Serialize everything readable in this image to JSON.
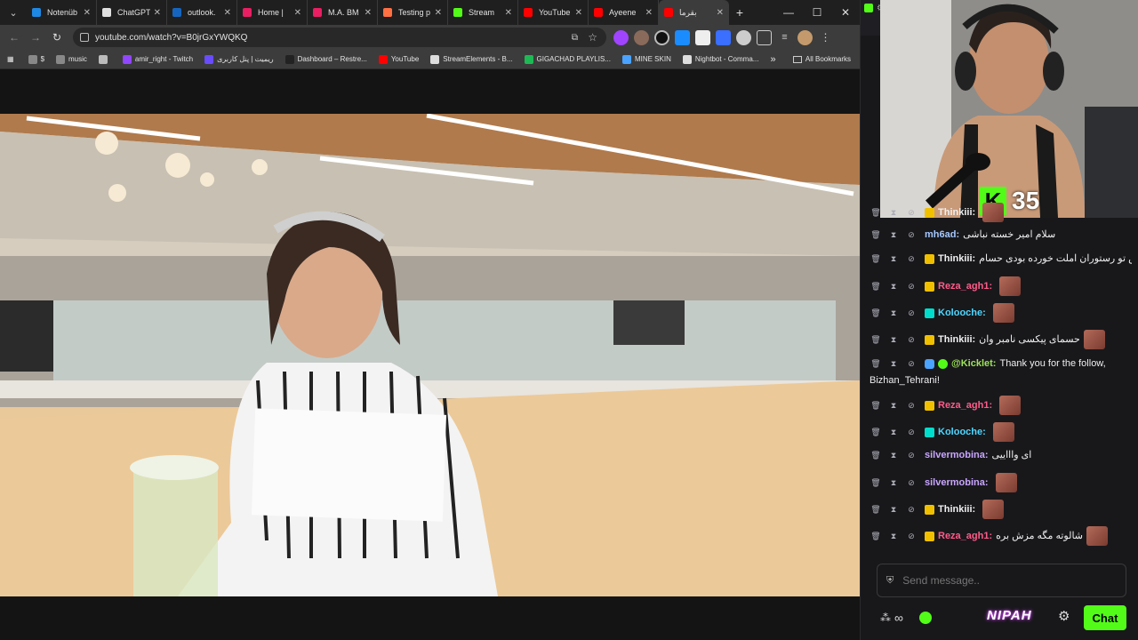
{
  "browser": {
    "tabs": [
      {
        "label": "Notenüb",
        "color": "#1e88e5"
      },
      {
        "label": "ChatGPT",
        "color": "#e0e0e0"
      },
      {
        "label": "outlook.",
        "color": "#1565c0"
      },
      {
        "label": "Home | ",
        "color": "#e91e63"
      },
      {
        "label": "M.A. BM",
        "color": "#e91e63"
      },
      {
        "label": "Testing p",
        "color": "#ff7043"
      },
      {
        "label": "Stream",
        "color": "#53fc18"
      },
      {
        "label": "YouTube",
        "color": "#ff0000"
      },
      {
        "label": "Ayeene",
        "color": "#ff0000"
      },
      {
        "label": "بقرما",
        "color": "#ff0000"
      }
    ],
    "new_tab": "+",
    "url": "youtube.com/watch?v=B0jrGxYWQKQ",
    "bookmarks": [
      {
        "label": "$",
        "color": "#888"
      },
      {
        "label": "music",
        "color": "#888"
      },
      {
        "label": "",
        "color": "#bbb"
      },
      {
        "label": "amir_right - Twitch",
        "color": "#9146ff"
      },
      {
        "label": "ریمیت | پنل کاربری",
        "color": "#6a4cff"
      },
      {
        "label": "Dashboard – Restre...",
        "color": "#222"
      },
      {
        "label": "YouTube",
        "color": "#ff0000"
      },
      {
        "label": "StreamElements - B...",
        "color": "#ddd"
      },
      {
        "label": "GIGACHAD PLAYLIS...",
        "color": "#1db954"
      },
      {
        "label": "MINE SKIN",
        "color": "#4aa3ff"
      },
      {
        "label": "Nightbot - Comma...",
        "color": "#ddd"
      }
    ],
    "bookmarks_more": "»",
    "all_bookmarks": "All Bookmarks"
  },
  "stream_overlay": {
    "kick_count": "35"
  },
  "chat": {
    "messages": [
      {
        "user": "Thinkiii:",
        "color": "#efeff1",
        "badge": "sub",
        "text": "",
        "emote": true
      },
      {
        "user": "mh6ad:",
        "color": "#a5c8ff",
        "badge": "",
        "text": "سلام امیر خسته نباشی",
        "emote": false
      },
      {
        "user": "Thinkiii:",
        "color": "#efeff1",
        "badge": "sub",
        "text": "کاش تو رستوران املت خورده بودی حسام",
        "emote": false
      },
      {
        "user": "Reza_agh1:",
        "color": "#ff5c8a",
        "badge": "sub",
        "text": "",
        "emote": true
      },
      {
        "user": "Kolooche:",
        "color": "#4fd6ff",
        "badge": "mod",
        "text": "",
        "emote": true
      },
      {
        "user": "Thinkiii:",
        "color": "#efeff1",
        "badge": "sub",
        "text": "حسمای پیکسی نامبر وان",
        "emote": true
      },
      {
        "user": "@Kicklet:",
        "color": "#9ee35a",
        "badge": "bot",
        "text": "Thank you for the follow,",
        "emote": false
      },
      {
        "user": "",
        "color": "#efeff1",
        "badge": "",
        "text": "Bizhan_Tehrani!",
        "emote": false
      },
      {
        "user": "Reza_agh1:",
        "color": "#ff5c8a",
        "badge": "sub",
        "text": "",
        "emote": true
      },
      {
        "user": "Kolooche:",
        "color": "#4fd6ff",
        "badge": "mod",
        "text": "",
        "emote": true
      },
      {
        "user": "silvermobina:",
        "color": "#c9a6ff",
        "badge": "",
        "text": "ای واااییی",
        "emote": false
      },
      {
        "user": "silvermobina:",
        "color": "#c9a6ff",
        "badge": "",
        "text": "",
        "emote": true
      },
      {
        "user": "Thinkiii:",
        "color": "#efeff1",
        "badge": "sub",
        "text": "",
        "emote": true
      },
      {
        "user": "Reza_agh1:",
        "color": "#ff5c8a",
        "badge": "sub",
        "text": "شالوته مگه مزش بره",
        "emote": true
      }
    ],
    "input_placeholder": "Send message..",
    "infinity": "∞",
    "logo_text": "NIPAH",
    "chat_button": "Chat"
  }
}
